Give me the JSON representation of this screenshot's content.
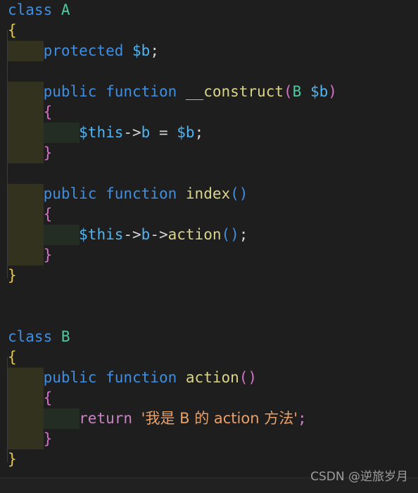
{
  "editor": {
    "language": "PHP",
    "theme": "dark",
    "background_color": "#1e1e1e",
    "indent_guide_level1_color": "#33321f",
    "indent_guide_level2_color": "#242d23",
    "font_size_px": 21,
    "line_height_px": 29,
    "tab_size": 4
  },
  "colors": {
    "keyword": "#3f8fe0",
    "class_name": "#4ec9a0",
    "function_name": "#d9d58a",
    "variable": "#4fb4f0",
    "punctuation": "#d4d4d4",
    "brace_outer": "#e7c84a",
    "brace_inner": "#d472c8",
    "return_keyword": "#c586c0",
    "string": "#e8a06a",
    "watermark": "#9d9d9d"
  },
  "code": {
    "full_text": "class A\n{\n    protected $b;\n\n    public function __construct(B $b)\n    {\n        $this->b = $b;\n    }\n\n    public function index()\n    {\n        $this->b->action();\n    }\n}\n\n\nclass B\n{\n    public function action()\n    {\n        return '我是 B 的 action 方法';\n    }\n}",
    "lines": [
      {
        "n": 1,
        "indent": 0,
        "tokens": [
          {
            "t": "class",
            "c": "kw"
          },
          {
            "t": " ",
            "c": "punc"
          },
          {
            "t": "A",
            "c": "cls"
          }
        ]
      },
      {
        "n": 2,
        "indent": 0,
        "tokens": [
          {
            "t": "{",
            "c": "brace-y"
          }
        ]
      },
      {
        "n": 3,
        "indent": 1,
        "tokens": [
          {
            "t": "    ",
            "c": "punc"
          },
          {
            "t": "protected",
            "c": "kw"
          },
          {
            "t": " ",
            "c": "punc"
          },
          {
            "t": "$b",
            "c": "var"
          },
          {
            "t": ";",
            "c": "punc"
          }
        ]
      },
      {
        "n": 4,
        "indent": 0,
        "tokens": []
      },
      {
        "n": 5,
        "indent": 1,
        "tokens": [
          {
            "t": "    ",
            "c": "punc"
          },
          {
            "t": "public",
            "c": "kw"
          },
          {
            "t": " ",
            "c": "punc"
          },
          {
            "t": "function",
            "c": "kw"
          },
          {
            "t": " ",
            "c": "punc"
          },
          {
            "t": "__construct",
            "c": "fn"
          },
          {
            "t": "(",
            "c": "paren-m"
          },
          {
            "t": "B",
            "c": "cls"
          },
          {
            "t": " ",
            "c": "punc"
          },
          {
            "t": "$b",
            "c": "var"
          },
          {
            "t": ")",
            "c": "paren-m"
          }
        ]
      },
      {
        "n": 6,
        "indent": 1,
        "tokens": [
          {
            "t": "    ",
            "c": "punc"
          },
          {
            "t": "{",
            "c": "brace-m"
          }
        ]
      },
      {
        "n": 7,
        "indent": 2,
        "tokens": [
          {
            "t": "        ",
            "c": "punc"
          },
          {
            "t": "$this",
            "c": "var"
          },
          {
            "t": "->",
            "c": "punc"
          },
          {
            "t": "b",
            "c": "var"
          },
          {
            "t": " = ",
            "c": "punc"
          },
          {
            "t": "$b",
            "c": "var"
          },
          {
            "t": ";",
            "c": "punc"
          }
        ]
      },
      {
        "n": 8,
        "indent": 1,
        "tokens": [
          {
            "t": "    ",
            "c": "punc"
          },
          {
            "t": "}",
            "c": "brace-m"
          }
        ]
      },
      {
        "n": 9,
        "indent": 0,
        "tokens": []
      },
      {
        "n": 10,
        "indent": 1,
        "tokens": [
          {
            "t": "    ",
            "c": "punc"
          },
          {
            "t": "public",
            "c": "kw"
          },
          {
            "t": " ",
            "c": "punc"
          },
          {
            "t": "function",
            "c": "kw"
          },
          {
            "t": " ",
            "c": "punc"
          },
          {
            "t": "index",
            "c": "fn"
          },
          {
            "t": "()",
            "c": "paren-b"
          }
        ]
      },
      {
        "n": 11,
        "indent": 1,
        "tokens": [
          {
            "t": "    ",
            "c": "punc"
          },
          {
            "t": "{",
            "c": "brace-m"
          }
        ]
      },
      {
        "n": 12,
        "indent": 2,
        "tokens": [
          {
            "t": "        ",
            "c": "punc"
          },
          {
            "t": "$this",
            "c": "var"
          },
          {
            "t": "->",
            "c": "punc"
          },
          {
            "t": "b",
            "c": "var"
          },
          {
            "t": "->",
            "c": "punc"
          },
          {
            "t": "action",
            "c": "fn"
          },
          {
            "t": "()",
            "c": "paren-b"
          },
          {
            "t": ";",
            "c": "punc"
          }
        ]
      },
      {
        "n": 13,
        "indent": 1,
        "tokens": [
          {
            "t": "    ",
            "c": "punc"
          },
          {
            "t": "}",
            "c": "brace-m"
          }
        ]
      },
      {
        "n": 14,
        "indent": 0,
        "tokens": [
          {
            "t": "}",
            "c": "brace-y"
          }
        ]
      },
      {
        "n": 15,
        "indent": 0,
        "tokens": []
      },
      {
        "n": 16,
        "indent": 0,
        "tokens": []
      },
      {
        "n": 17,
        "indent": 0,
        "tokens": [
          {
            "t": "class",
            "c": "kw"
          },
          {
            "t": " ",
            "c": "punc"
          },
          {
            "t": "B",
            "c": "cls"
          }
        ]
      },
      {
        "n": 18,
        "indent": 0,
        "tokens": [
          {
            "t": "{",
            "c": "brace-y"
          }
        ]
      },
      {
        "n": 19,
        "indent": 1,
        "tokens": [
          {
            "t": "    ",
            "c": "punc"
          },
          {
            "t": "public",
            "c": "kw"
          },
          {
            "t": " ",
            "c": "punc"
          },
          {
            "t": "function",
            "c": "kw"
          },
          {
            "t": " ",
            "c": "punc"
          },
          {
            "t": "action",
            "c": "fn"
          },
          {
            "t": "()",
            "c": "paren-m"
          }
        ]
      },
      {
        "n": 20,
        "indent": 1,
        "tokens": [
          {
            "t": "    ",
            "c": "punc"
          },
          {
            "t": "{",
            "c": "brace-m"
          }
        ]
      },
      {
        "n": 21,
        "indent": 2,
        "tokens": [
          {
            "t": "        ",
            "c": "punc"
          },
          {
            "t": "return",
            "c": "ret"
          },
          {
            "t": " ",
            "c": "punc"
          },
          {
            "t": "'我是 B 的 action 方法'",
            "c": "str cjk"
          },
          {
            "t": ";",
            "c": "ret"
          }
        ]
      },
      {
        "n": 22,
        "indent": 1,
        "tokens": [
          {
            "t": "    ",
            "c": "punc"
          },
          {
            "t": "}",
            "c": "brace-m"
          }
        ]
      },
      {
        "n": 23,
        "indent": 0,
        "tokens": [
          {
            "t": "}",
            "c": "brace-y"
          }
        ]
      }
    ]
  },
  "watermark": {
    "text": "CSDN @逆旅岁月"
  }
}
